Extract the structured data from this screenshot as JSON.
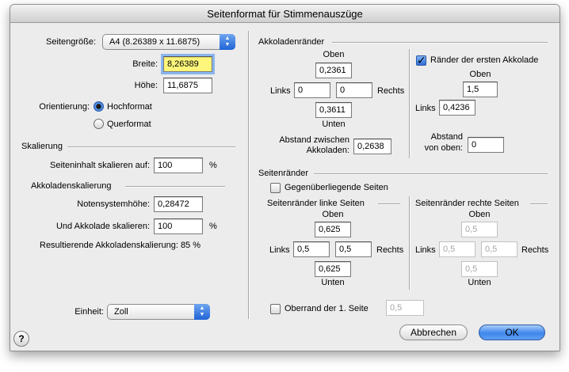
{
  "window": {
    "title": "Seitenformat für Stimmenauszüge"
  },
  "left": {
    "page_size_label": "Seitengröße:",
    "page_size_value": "A4 (8.26389 x 11.6875)",
    "width_label": "Breite:",
    "width_value": "8,26389",
    "height_label": "Höhe:",
    "height_value": "11,6875",
    "orientation_label": "Orientierung:",
    "portrait_label": "Hochformat",
    "landscape_label": "Querformat",
    "scaling_heading": "Skalierung",
    "scale_content_label": "Seiteninhalt skalieren auf:",
    "scale_content_value": "100",
    "percent": "%",
    "system_scaling_heading": "Akkoladenskalierung",
    "staff_height_label": "Notensystemhöhe:",
    "staff_height_value": "0,28472",
    "system_scale_label": "Und Akkolade skalieren:",
    "system_scale_value": "100",
    "result_label": "Resultierende Akkoladenskalierung: 85 %",
    "unit_label": "Einheit:",
    "unit_value": "Zoll"
  },
  "system_margins": {
    "heading": "Akkoladenränder",
    "top_label": "Oben",
    "top_value": "0,2361",
    "left_label": "Links",
    "left_value": "0",
    "right_value": "0",
    "right_label": "Rechts",
    "bottom_value": "0,3611",
    "bottom_label": "Unten",
    "distance_label_1": "Abstand zwischen",
    "distance_label_2": "Akkoladen:",
    "distance_value": "0,2638",
    "first_system_label": "Ränder der ersten Akkolade",
    "first_top_label": "Oben",
    "first_top_value": "1,5",
    "first_left_label": "Links",
    "first_left_value": "0,4236",
    "first_distance_label_1": "Abstand",
    "first_distance_label_2": "von oben:",
    "first_distance_value": "0"
  },
  "page_margins": {
    "heading": "Seitenränder",
    "facing_pages_label": "Gegenüberliegende Seiten",
    "left_pages_heading": "Seitenränder linke Seiten",
    "left_top_label": "Oben",
    "left_top_value": "0,625",
    "left_left_label": "Links",
    "left_left_value": "0,5",
    "left_right_value": "0,5",
    "left_right_label": "Rechts",
    "left_bottom_value": "0,625",
    "left_bottom_label": "Unten",
    "right_pages_heading": "Seitenränder rechte Seiten",
    "right_top_label": "Oben",
    "right_top_value": "0,5",
    "right_left_label": "Links",
    "right_left_value": "0,5",
    "right_right_value": "0,5",
    "right_right_label": "Rechts",
    "right_bottom_value": "0,5",
    "right_bottom_label": "Unten",
    "first_page_top_label": "Oberrand der 1. Seite",
    "first_page_top_value": "0,5"
  },
  "buttons": {
    "help": "?",
    "cancel": "Abbrechen",
    "ok": "OK"
  },
  "colors": {
    "accent": "#3d86ec",
    "highlight_field": "#fdf67a"
  }
}
